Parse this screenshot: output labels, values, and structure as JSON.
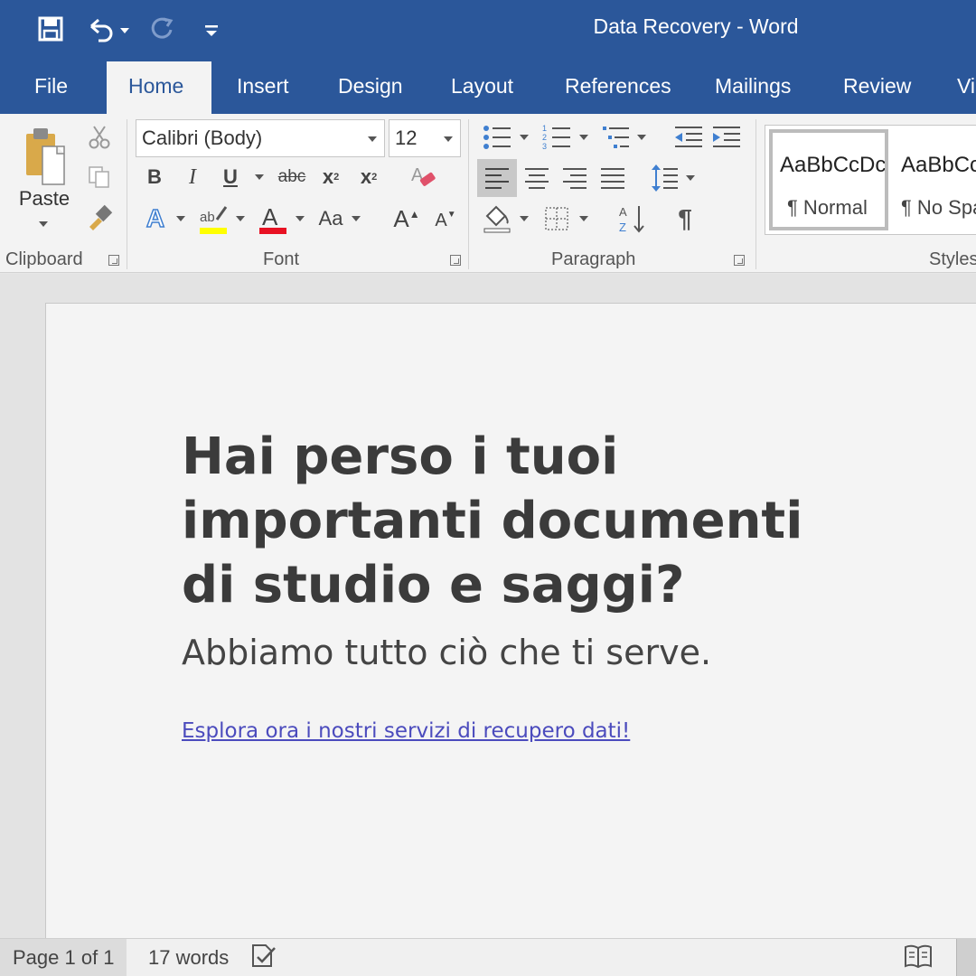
{
  "window": {
    "title": "Data Recovery - Word",
    "accent": "#2b579a"
  },
  "quick_access": {
    "icons": [
      "save-icon",
      "undo-icon",
      "redo-icon",
      "customize-icon"
    ]
  },
  "tabs": [
    {
      "label": "File"
    },
    {
      "label": "Home",
      "active": true
    },
    {
      "label": "Insert"
    },
    {
      "label": "Design"
    },
    {
      "label": "Layout"
    },
    {
      "label": "References"
    },
    {
      "label": "Mailings"
    },
    {
      "label": "Review"
    },
    {
      "label": "Vi"
    }
  ],
  "ribbon": {
    "clipboard": {
      "label": "Clipboard",
      "paste_label": "Paste"
    },
    "font": {
      "label": "Font",
      "font_name": "Calibri (Body)",
      "font_size": "12",
      "bold": "B",
      "italic": "I",
      "underline": "U",
      "strikethrough": "abc",
      "subscript": "x",
      "superscript": "x",
      "change_case": "Aa",
      "grow_font": "A",
      "shrink_font": "A",
      "text_effects": "A",
      "font_color": "A",
      "highlight_color": "#ffff00",
      "font_color_value": "#e81123"
    },
    "paragraph": {
      "label": "Paragraph"
    },
    "styles": {
      "label": "Styles",
      "items": [
        {
          "sample": "AaBbCcDc",
          "name": "¶ Normal"
        },
        {
          "sample": "AaBbCc",
          "name": "¶ No Spa"
        }
      ]
    }
  },
  "document": {
    "headline_lines": [
      "Hai perso i tuoi",
      "importanti documenti",
      "di studio e saggi?"
    ],
    "subheading": "Abbiamo tutto ciò che ti serve.",
    "link": "Esplora ora i nostri servizi di recupero dati!"
  },
  "status": {
    "page": "Page 1 of 1",
    "words": "17 words"
  }
}
